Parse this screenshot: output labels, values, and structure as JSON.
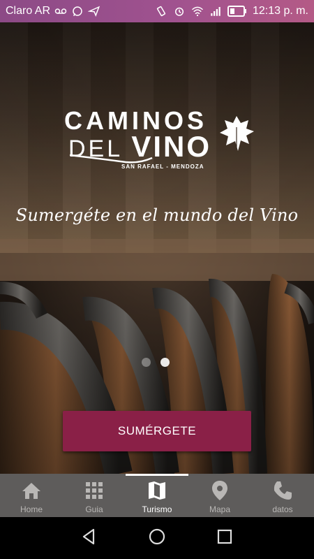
{
  "status_bar": {
    "carrier": "Claro AR",
    "time": "12:13 p. m.",
    "icons_left": [
      "voicemail-icon",
      "whatsapp-icon",
      "send-icon"
    ],
    "icons_right": [
      "vibrate-icon",
      "alarm-icon",
      "wifi-icon",
      "signal-icon",
      "battery-icon"
    ]
  },
  "logo": {
    "line1": "CAMINOS",
    "line2_part1": "DEL",
    "line2_part2": "VINO",
    "subtitle": "SAN RAFAEL - MENDOZA"
  },
  "hero": {
    "tagline": "Sumergéte en el mundo del Vino",
    "carousel_pages": 2,
    "carousel_active": 2,
    "cta_label": "SUMÉRGETE"
  },
  "bottom_nav": {
    "items": [
      {
        "label": "Home",
        "icon": "home-icon"
      },
      {
        "label": "Guia",
        "icon": "grid-icon"
      },
      {
        "label": "Turismo",
        "icon": "map-book-icon"
      },
      {
        "label": "Mapa",
        "icon": "location-pin-icon"
      },
      {
        "label": "datos",
        "icon": "phone-icon"
      }
    ],
    "active": "Turismo"
  },
  "colors": {
    "status_bar": "#a0528f",
    "cta": "#8a2047",
    "bottom_nav": "#5e5c5b"
  }
}
